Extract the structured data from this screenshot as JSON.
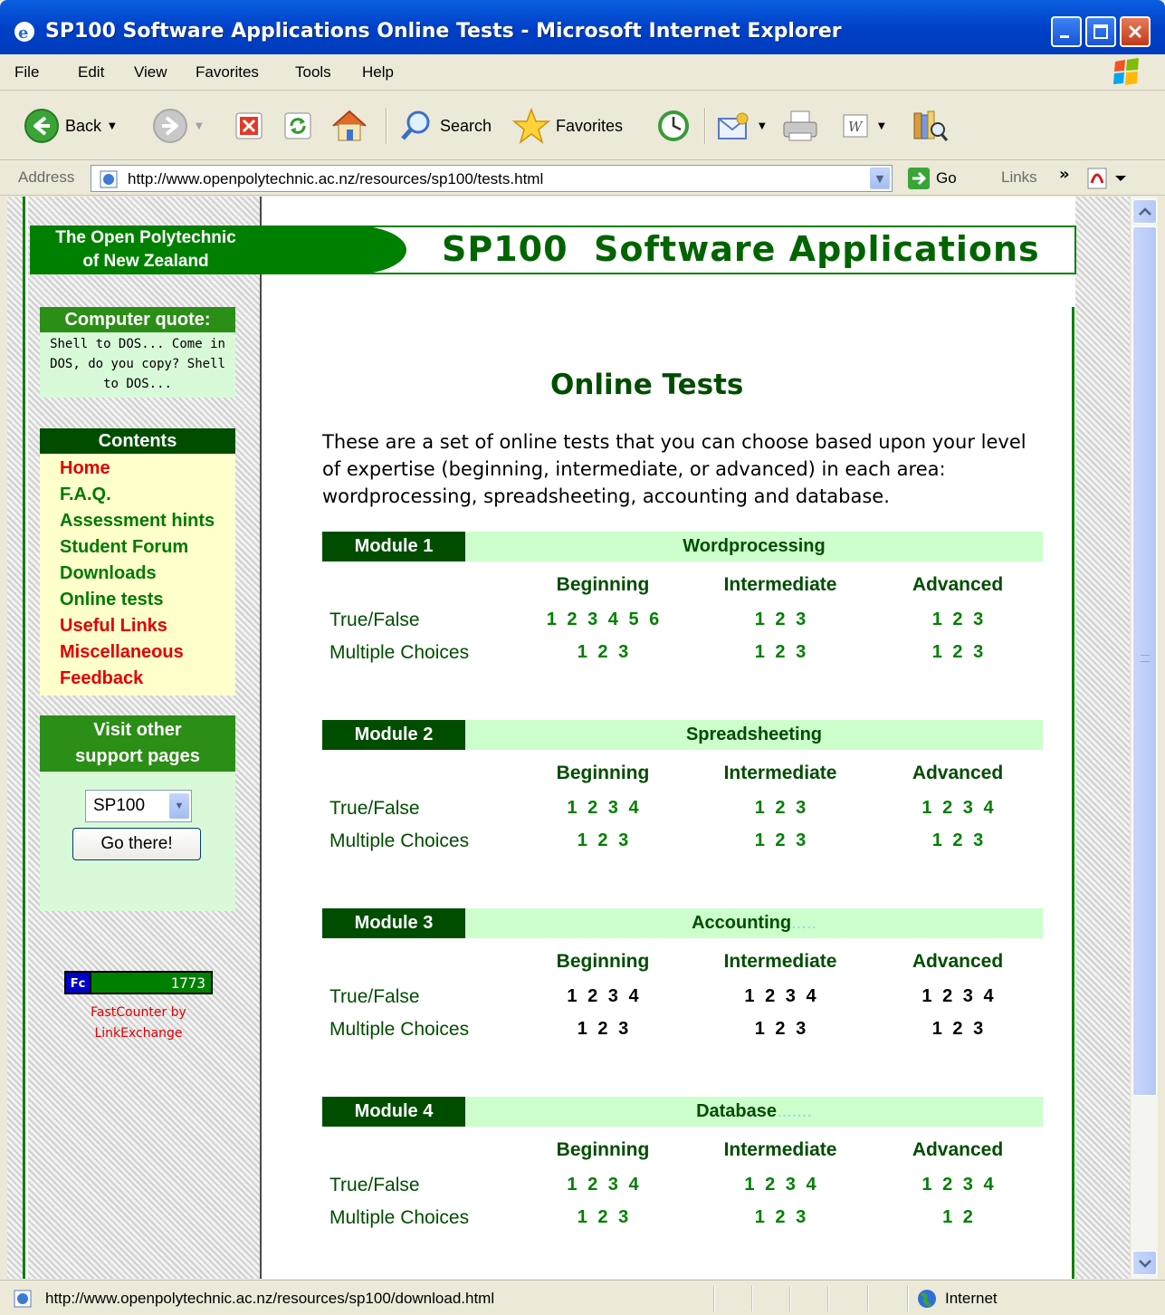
{
  "window": {
    "title": "SP100 Software Applications Online Tests - Microsoft Internet Explorer"
  },
  "menu": [
    "File",
    "Edit",
    "View",
    "Favorites",
    "Tools",
    "Help"
  ],
  "toolbar": {
    "back_label": "Back",
    "search_label": "Search",
    "favorites_label": "Favorites"
  },
  "address": {
    "label": "Address",
    "url": "http://www.openpolytechnic.ac.nz/resources/sp100/tests.html",
    "go_label": "Go",
    "links_label": "Links"
  },
  "banner": {
    "org_line1": "The Open Polytechnic",
    "org_line2": "of New Zealand",
    "title": "SP100  Software Applications"
  },
  "sidebar": {
    "quote_title": "Computer quote:",
    "quote_text": "Shell to DOS... Come in DOS, do you copy? Shell to DOS...",
    "contents_title": "Contents",
    "contents": [
      {
        "label": "Home",
        "color": "#e00000"
      },
      {
        "label": "F.A.Q.",
        "color": "#007a00"
      },
      {
        "label": "Assessment hints",
        "color": "#007a00"
      },
      {
        "label": "Student Forum",
        "color": "#007a00"
      },
      {
        "label": "Downloads",
        "color": "#007a00"
      },
      {
        "label": "Online tests",
        "color": "#007a00"
      },
      {
        "label": "Useful Links",
        "color": "#e00000"
      },
      {
        "label": "Miscellaneous",
        "color": "#e00000"
      },
      {
        "label": "Feedback",
        "color": "#e00000"
      }
    ],
    "visit_title_1": "Visit other",
    "visit_title_2": "support pages",
    "select_value": "SP100",
    "go_button": "Go there!",
    "counter_logo": "Fc",
    "counter_value": "1773",
    "counter_caption_1": "FastCounter by",
    "counter_caption_2": "LinkExchange"
  },
  "main": {
    "heading": "Online Tests",
    "intro": "These are a set of online tests that you can choose based upon your level of expertise (beginning, intermediate, or advanced) in each area: wordprocessing, spreadsheeting, accounting and database.",
    "levels": [
      "Beginning",
      "Intermediate",
      "Advanced"
    ],
    "row_labels": [
      "True/False",
      "Multiple Choices"
    ],
    "modules": [
      {
        "tag": "Module 1",
        "name": "Wordprocessing",
        "trail": "",
        "true_false": [
          "1 2 3 4 5 6",
          "1 2 3",
          "1 2 3"
        ],
        "multiple": [
          "1 2 3",
          "1 2 3",
          "1 2 3"
        ],
        "linked": true
      },
      {
        "tag": "Module 2",
        "name": "Spreadsheeting",
        "trail": "",
        "true_false": [
          "1 2 3 4",
          "1 2 3",
          "1 2 3 4"
        ],
        "multiple": [
          "1 2 3",
          "1 2 3",
          "1 2 3"
        ],
        "linked": true
      },
      {
        "tag": "Module 3",
        "name": "Accounting",
        "trail": ".....",
        "true_false": [
          "1 2 3 4",
          "1 2 3 4",
          "1 2 3 4"
        ],
        "multiple": [
          "1 2 3",
          "1 2 3",
          "1 2 3"
        ],
        "linked": false
      },
      {
        "tag": "Module 4",
        "name": "Database",
        "trail": ".......",
        "true_false": [
          "1 2 3 4",
          "1 2 3 4",
          "1 2 3 4"
        ],
        "multiple": [
          "1 2 3",
          "1 2 3",
          "1 2"
        ],
        "linked": true
      }
    ]
  },
  "status": {
    "text": "http://www.openpolytechnic.ac.nz/resources/sp100/download.html",
    "zone": "Internet"
  }
}
